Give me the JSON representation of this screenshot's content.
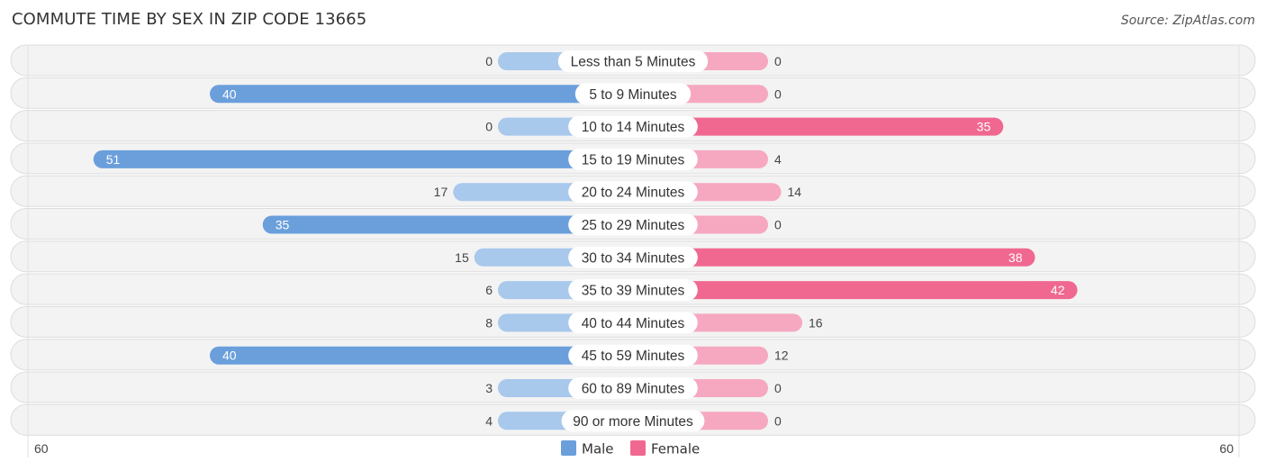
{
  "header": {
    "title": "COMMUTE TIME BY SEX IN ZIP CODE 13665",
    "source": "Source: ZipAtlas.com"
  },
  "chart_data": {
    "type": "bar",
    "orientation": "horizontal-diverging",
    "title": "COMMUTE TIME BY SEX IN ZIP CODE 13665",
    "categories": [
      "Less than 5 Minutes",
      "5 to 9 Minutes",
      "10 to 14 Minutes",
      "15 to 19 Minutes",
      "20 to 24 Minutes",
      "25 to 29 Minutes",
      "30 to 34 Minutes",
      "35 to 39 Minutes",
      "40 to 44 Minutes",
      "45 to 59 Minutes",
      "60 to 89 Minutes",
      "90 or more Minutes"
    ],
    "series": [
      {
        "name": "Male",
        "color": "#6a9fdc",
        "light_color": "#a8c8ec",
        "values": [
          0,
          40,
          0,
          51,
          17,
          35,
          15,
          6,
          8,
          40,
          3,
          4
        ]
      },
      {
        "name": "Female",
        "color": "#f06890",
        "light_color": "#f6a8c0",
        "values": [
          0,
          0,
          35,
          4,
          14,
          0,
          38,
          42,
          16,
          12,
          0,
          0
        ]
      }
    ],
    "axis": {
      "left_label": "60",
      "right_label": "60",
      "max": 60
    },
    "legend": {
      "position": "bottom-center",
      "items": [
        "Male",
        "Female"
      ]
    },
    "grid": false
  }
}
